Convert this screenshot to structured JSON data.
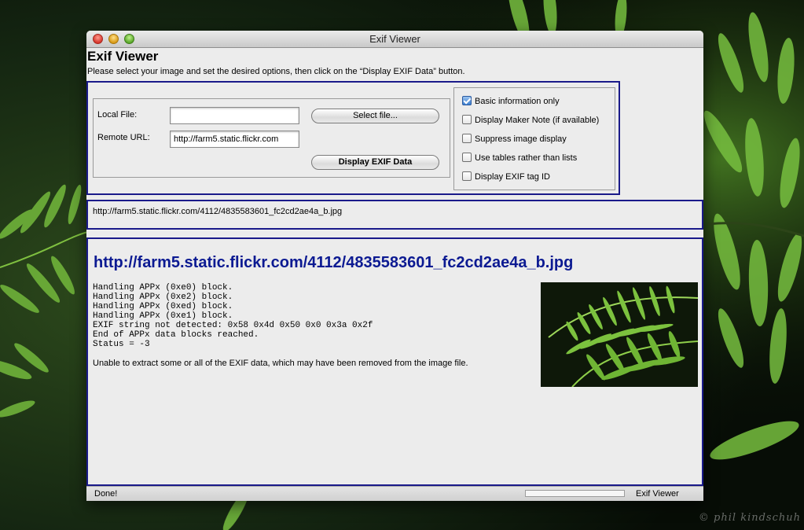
{
  "window": {
    "title": "Exif Viewer"
  },
  "app": {
    "heading": "Exif Viewer",
    "instructions": "Please select your image and set the desired options, then click on the “Display EXIF Data” button."
  },
  "form": {
    "local_file_label": "Local File:",
    "local_file_value": "",
    "remote_url_label": "Remote URL:",
    "remote_url_value": "http://farm5.static.flickr.com",
    "select_file_button": "Select file...",
    "display_button": "Display EXIF Data"
  },
  "options": [
    {
      "label": "Basic information only",
      "checked": true
    },
    {
      "label": "Display Maker Note (if available)",
      "checked": false
    },
    {
      "label": "Suppress image display",
      "checked": false
    },
    {
      "label": "Use tables rather than lists",
      "checked": false
    },
    {
      "label": "Display EXIF tag ID",
      "checked": false
    }
  ],
  "url_echo": "http://farm5.static.flickr.com/4112/4835583601_fc2cd2ae4a_b.jpg",
  "result": {
    "title": "http://farm5.static.flickr.com/4112/4835583601_fc2cd2ae4a_b.jpg",
    "log": [
      "Handling APPx (0xe0) block.",
      "Handling APPx (0xe2) block.",
      "Handling APPx (0xed) block.",
      "Handling APPx (0xe1) block.",
      "EXIF string not detected: 0x58 0x4d 0x50 0x0 0x3a 0x2f",
      "End of APPx data blocks reached.",
      "Status = -3"
    ],
    "message": "Unable to extract some or all of the EXIF data, which may have been removed from the image file.",
    "thumbnail_icon": "fern-photo-thumbnail"
  },
  "statusbar": {
    "status": "Done!",
    "progress_percent": 0,
    "app_name": "Exif Viewer"
  },
  "wallpaper": {
    "watermark": "© phil kindschuh",
    "dominant_color": "#4c8a1e"
  },
  "colors": {
    "frame_border": "#1a1a8a",
    "result_title": "#0c1a92",
    "window_bg": "#ececec"
  }
}
